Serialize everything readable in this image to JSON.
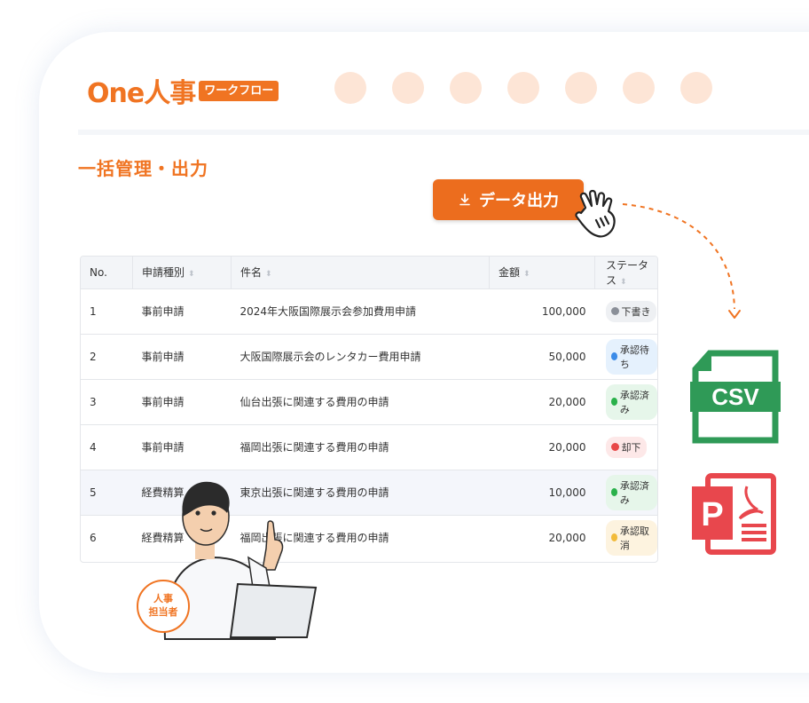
{
  "header": {
    "logo_text": "One人事",
    "logo_badge": "ワークフロー"
  },
  "page": {
    "title": "一括管理・出力"
  },
  "export_button": {
    "label": "データ出力",
    "icon": "download-icon"
  },
  "table": {
    "columns": [
      "No.",
      "申請種別",
      "件名",
      "金額",
      "ステータス"
    ],
    "rows": [
      {
        "no": "1",
        "type": "事前申請",
        "subject": "2024年大阪国際展示会参加費用申請",
        "amount": "100,000",
        "status": "下書き",
        "status_kind": "draft"
      },
      {
        "no": "2",
        "type": "事前申請",
        "subject": "大阪国際展示会のレンタカー費用申請",
        "amount": "50,000",
        "status": "承認待ち",
        "status_kind": "wait"
      },
      {
        "no": "3",
        "type": "事前申請",
        "subject": "仙台出張に関連する費用の申請",
        "amount": "20,000",
        "status": "承認済み",
        "status_kind": "done"
      },
      {
        "no": "4",
        "type": "事前申請",
        "subject": "福岡出張に関連する費用の申請",
        "amount": "20,000",
        "status": "却下",
        "status_kind": "reject"
      },
      {
        "no": "5",
        "type": "経費精算",
        "subject": "東京出張に関連する費用の申請",
        "amount": "10,000",
        "status": "承認済み",
        "status_kind": "done"
      },
      {
        "no": "6",
        "type": "経費精算",
        "subject": "福岡出張に関連する費用の申請",
        "amount": "20,000",
        "status": "承認取消",
        "status_kind": "cancel"
      }
    ]
  },
  "files": {
    "csv_label": "CSV",
    "pdf_label": "P"
  },
  "badge": {
    "role": "人事\n担当者"
  },
  "colors": {
    "accent": "#f07422",
    "button": "#ec6d1e",
    "csv_green": "#2f9a57",
    "pdf_red": "#e8474d"
  }
}
